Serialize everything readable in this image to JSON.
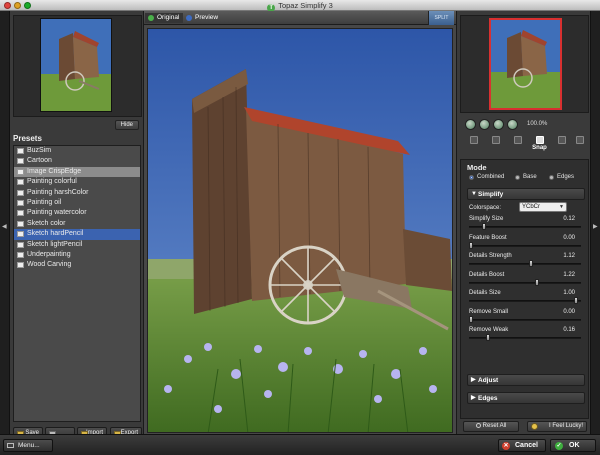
{
  "window": {
    "title": "Topaz Simplify 3"
  },
  "left_panel": {
    "hide_label": "Hide",
    "presets_title": "Presets",
    "presets": [
      "BuzSim",
      "Cartoon",
      "Image CrispEdge",
      "Painting colorful",
      "Painting harshColor",
      "Painting oil",
      "Painting watercolor",
      "Sketch color",
      "Sketch hardPencil",
      "Sketch lightPencil",
      "Underpainting",
      "Wood Carving"
    ],
    "hover_preset": "Image CrispEdge",
    "selected_preset": "Sketch hardPencil",
    "footer": {
      "save": "Save",
      "import": "Import",
      "export": "Export"
    }
  },
  "center": {
    "tabs": {
      "original": "Original",
      "preview": "Preview"
    },
    "active_tab": "Original",
    "compare_label": "SPLIT"
  },
  "right_panel": {
    "zoom_level": "100.0%",
    "tools": {
      "snap": "Snap"
    },
    "mode": {
      "title": "Mode",
      "options": [
        "Combined",
        "Base",
        "Edges"
      ],
      "selected": "Combined"
    },
    "simplify": {
      "title": "Simplify",
      "colorspace_label": "Colorspace:",
      "colorspace_value": "YCbCr",
      "sliders": [
        {
          "label": "Simplify Size",
          "value": "0.12",
          "level": 0.12
        },
        {
          "label": "Feature Boost",
          "value": "0.00",
          "level": 0.0
        },
        {
          "label": "Details Strength",
          "value": "1.12",
          "level": 0.56
        },
        {
          "label": "Details Boost",
          "value": "1.22",
          "level": 0.61
        },
        {
          "label": "Details Size",
          "value": "1.00",
          "level": 0.97
        },
        {
          "label": "Remove Small",
          "value": "0.00",
          "level": 0.0
        },
        {
          "label": "Remove Weak",
          "value": "0.16",
          "level": 0.16
        }
      ]
    },
    "adjust_title": "Adjust",
    "edges_title": "Edges",
    "reset_label": "Reset All",
    "lucky_label": "I Feel Lucky!"
  },
  "bottom": {
    "menu_label": "Menu...",
    "cancel_label": "Cancel",
    "ok_label": "OK"
  }
}
